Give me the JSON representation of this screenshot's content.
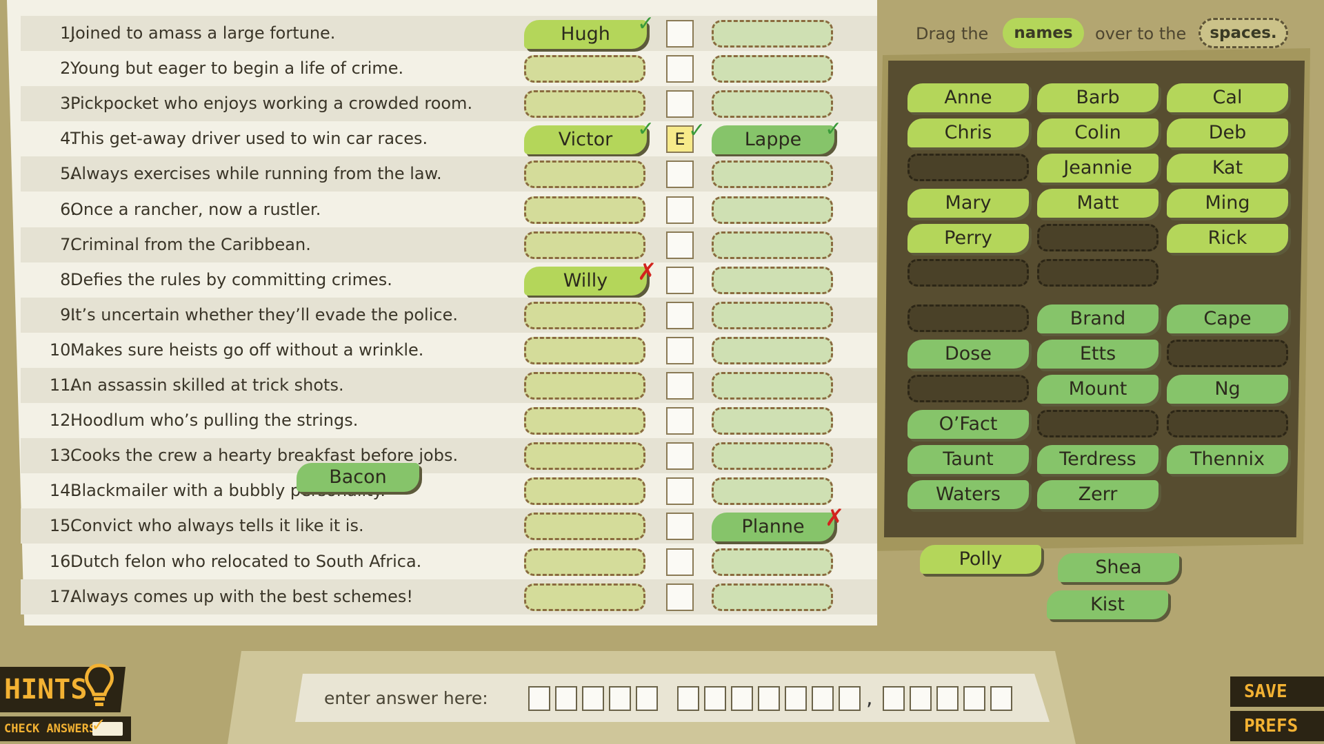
{
  "instructions": {
    "pre": "Drag the",
    "names": "names",
    "mid": "over to the",
    "spaces": "spaces."
  },
  "clues": [
    {
      "num": "1.",
      "text": "Joined to amass a large fortune.",
      "first": "Hugh",
      "first_mark": "check",
      "initial": "",
      "last": "",
      "last_mark": ""
    },
    {
      "num": "2.",
      "text": "Young but eager to begin a life of crime.",
      "first": "",
      "first_mark": "",
      "initial": "",
      "last": "",
      "last_mark": ""
    },
    {
      "num": "3.",
      "text": "Pickpocket who enjoys working a crowded room.",
      "first": "",
      "first_mark": "",
      "initial": "",
      "last": "",
      "last_mark": ""
    },
    {
      "num": "4.",
      "text": "This get-away driver used to win car races.",
      "first": "Victor",
      "first_mark": "check",
      "initial": "E",
      "initial_mark": "check",
      "last": "Lappe",
      "last_mark": "check"
    },
    {
      "num": "5.",
      "text": "Always exercises while running from the law.",
      "first": "",
      "first_mark": "",
      "initial": "",
      "last": "",
      "last_mark": ""
    },
    {
      "num": "6.",
      "text": "Once a rancher, now a rustler.",
      "first": "",
      "first_mark": "",
      "initial": "",
      "last": "",
      "last_mark": ""
    },
    {
      "num": "7.",
      "text": "Criminal from the Caribbean.",
      "first": "",
      "first_mark": "",
      "initial": "",
      "last": "",
      "last_mark": ""
    },
    {
      "num": "8.",
      "text": "Defies the rules by committing crimes.",
      "first": "Willy",
      "first_mark": "cross",
      "initial": "",
      "last": "",
      "last_mark": ""
    },
    {
      "num": "9.",
      "text": "It’s uncertain whether they’ll evade the police.",
      "first": "",
      "first_mark": "",
      "initial": "",
      "last": "",
      "last_mark": ""
    },
    {
      "num": "10.",
      "text": "Makes sure heists go off without a wrinkle.",
      "first": "",
      "first_mark": "",
      "initial": "",
      "last": "",
      "last_mark": ""
    },
    {
      "num": "11.",
      "text": "An assassin skilled at trick shots.",
      "first": "",
      "first_mark": "",
      "initial": "",
      "last": "",
      "last_mark": ""
    },
    {
      "num": "12.",
      "text": "Hoodlum who’s pulling the strings.",
      "first": "",
      "first_mark": "",
      "initial": "",
      "last": "",
      "last_mark": ""
    },
    {
      "num": "13.",
      "text": "Cooks the crew a hearty breakfast before jobs.",
      "first": "",
      "first_mark": "",
      "initial": "",
      "last": "",
      "last_mark": ""
    },
    {
      "num": "14.",
      "text": "Blackmailer with a bubbly personality.",
      "first": "",
      "first_mark": "",
      "initial": "",
      "last": "",
      "last_mark": ""
    },
    {
      "num": "15.",
      "text": "Convict who always tells it like it is.",
      "first": "",
      "first_mark": "",
      "initial": "",
      "last": "Planne",
      "last_mark": "cross"
    },
    {
      "num": "16.",
      "text": "Dutch felon who relocated to South Africa.",
      "first": "",
      "first_mark": "",
      "initial": "",
      "last": "",
      "last_mark": ""
    },
    {
      "num": "17.",
      "text": "Always comes up with the best schemes!",
      "first": "",
      "first_mark": "",
      "initial": "",
      "last": "",
      "last_mark": ""
    }
  ],
  "dragging_tile": "Bacon",
  "first_name_bank": [
    [
      "Anne",
      "Barb",
      "Cal"
    ],
    [
      "Chris",
      "Colin",
      "Deb"
    ],
    [
      "",
      "Jeannie",
      "Kat"
    ],
    [
      "Mary",
      "Matt",
      "Ming"
    ],
    [
      "Perry",
      "",
      "Rick"
    ],
    [
      "",
      "",
      null
    ]
  ],
  "last_name_bank": [
    [
      "",
      "Brand",
      "Cape"
    ],
    [
      "Dose",
      "Etts",
      ""
    ],
    [
      "",
      "Mount",
      "Ng"
    ],
    [
      "O’Fact",
      "",
      ""
    ],
    [
      "Taunt",
      "Terdress",
      "Thennix"
    ],
    [
      "Waters",
      "Zerr",
      null
    ]
  ],
  "loose_tiles": [
    {
      "label": "Polly",
      "kind": "first"
    },
    {
      "label": "Shea",
      "kind": "last"
    },
    {
      "label": "Kist",
      "kind": "last"
    }
  ],
  "answer": {
    "label": "enter answer here:",
    "groups": [
      5,
      7,
      5
    ]
  },
  "buttons": {
    "hints": "HINTS",
    "check_answers": "CHECK ANSWERS",
    "save": "SAVE",
    "prefs": "PREFS"
  },
  "colors": {
    "background": "#b3a671",
    "sheet": "#f3f1e6",
    "first_tile": "#b4d65a",
    "last_tile": "#86c46a",
    "bank_panel": "#574d30",
    "check": "#3a9a3a",
    "cross": "#d2231d",
    "button_text": "#f3b233"
  }
}
